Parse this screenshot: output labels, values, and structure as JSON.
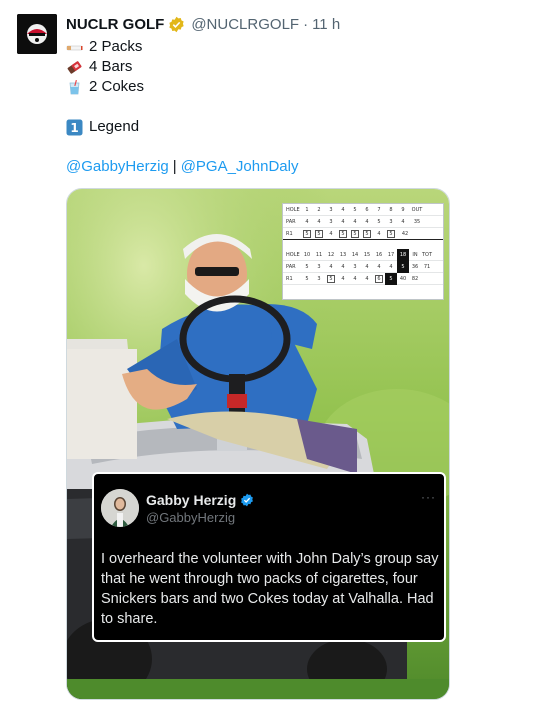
{
  "account": {
    "name": "NUCLR GOLF",
    "handle": "@NUCLRGOLF",
    "separator": "·",
    "time": "11 h"
  },
  "post": {
    "lines": [
      {
        "icon": "cigarette-icon",
        "text": "2 Packs"
      },
      {
        "icon": "candy-bar-icon",
        "text": "4 Bars"
      },
      {
        "icon": "cup-icon",
        "text": "2 Cokes"
      }
    ],
    "legend": {
      "icon": "keycap-1-icon",
      "text": "Legend"
    },
    "mentions": {
      "first": "@GabbyHerzig",
      "separator": "|",
      "second": "@PGA_JohnDaly"
    }
  },
  "scorecard": {
    "front": {
      "hole": [
        "HOLE",
        "1",
        "2",
        "3",
        "4",
        "5",
        "6",
        "7",
        "8",
        "9",
        "OUT"
      ],
      "par": [
        "PAR",
        "4",
        "4",
        "3",
        "4",
        "4",
        "4",
        "5",
        "3",
        "4",
        "35"
      ],
      "r1": [
        "R1",
        "5",
        "5",
        "4",
        "5",
        "5",
        "5",
        "4",
        "5",
        "42"
      ]
    },
    "back": {
      "hole": [
        "HOLE",
        "10",
        "11",
        "12",
        "13",
        "14",
        "15",
        "16",
        "17",
        "18",
        "IN",
        "TOT"
      ],
      "par": [
        "PAR",
        "5",
        "3",
        "4",
        "4",
        "3",
        "4",
        "4",
        "4",
        "5",
        "36",
        "71"
      ],
      "r1": [
        "R1",
        "5",
        "3",
        "5",
        "4",
        "4",
        "4",
        "6",
        "5",
        "40",
        "82"
      ]
    }
  },
  "quoted": {
    "name": "Gabby Herzig",
    "handle": "@GabbyHerzig",
    "more": "···",
    "text": "I overheard the volunteer with John Daly’s group say that he went through two packs of cigarettes, four Snickers bars and two Cokes today at Valhalla. Had to share."
  },
  "colors": {
    "link": "#1d9bf0",
    "gold_check": "#e2b719",
    "blue_check": "#1d9bf0"
  }
}
